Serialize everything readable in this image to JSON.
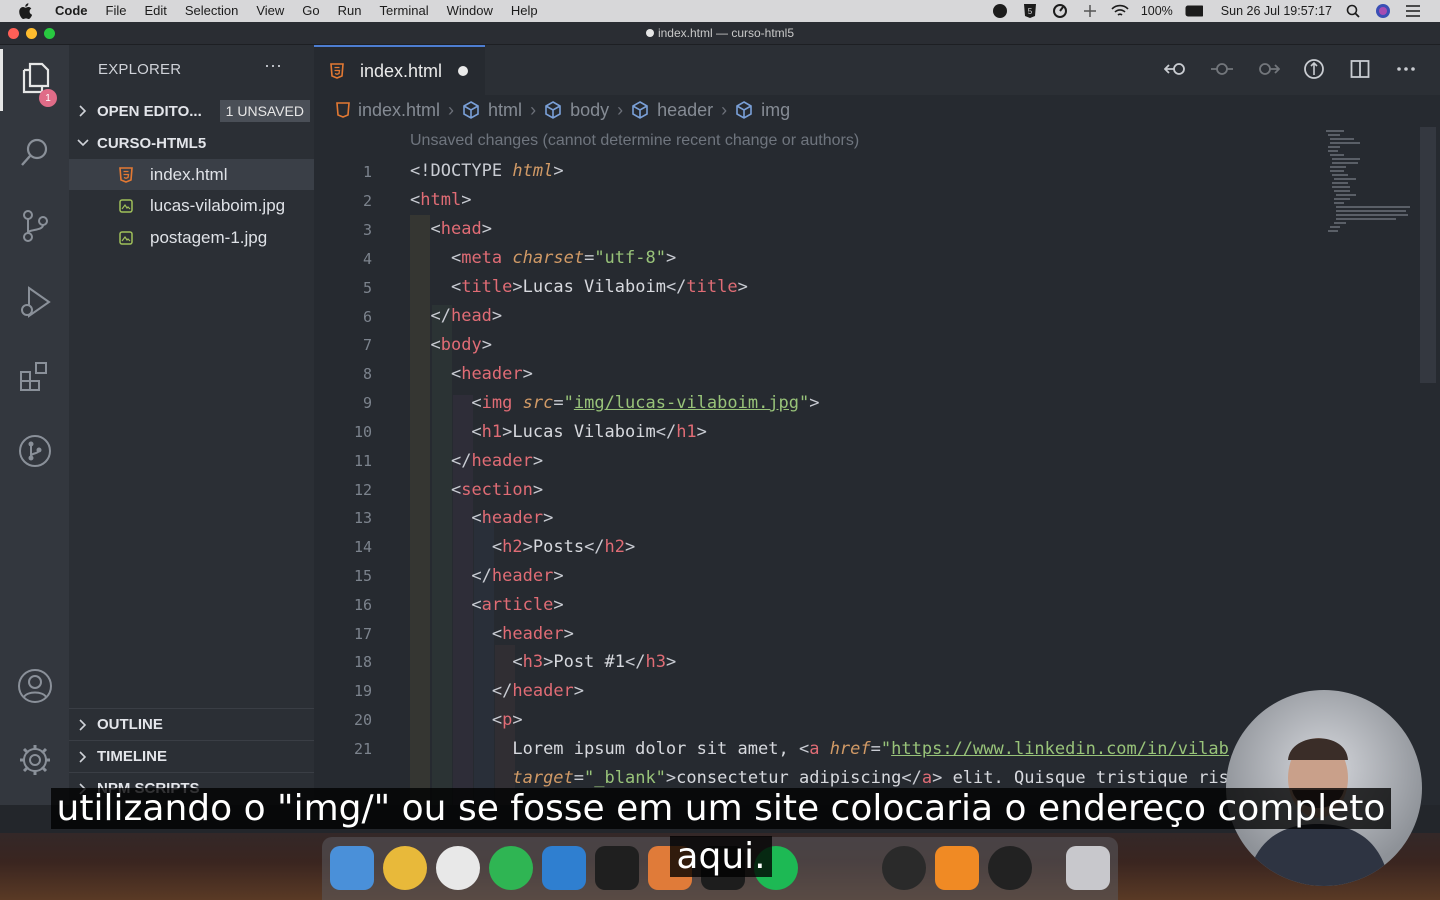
{
  "menubar": {
    "items": [
      "Code",
      "File",
      "Edit",
      "Selection",
      "View",
      "Go",
      "Run",
      "Terminal",
      "Window",
      "Help"
    ],
    "battery": "100%",
    "datetime": "Sun 26 Jul  19:57:17"
  },
  "window": {
    "title": "index.html — curso-html5"
  },
  "activity": {
    "explorer_badge": "1"
  },
  "sidebar": {
    "title": "EXPLORER",
    "more": "···",
    "open_editors": "OPEN EDITO...",
    "unsaved_badge": "1 UNSAVED",
    "folder": "CURSO-HTML5",
    "files": [
      "index.html",
      "lucas-vilaboim.jpg",
      "postagem-1.jpg"
    ],
    "panels": [
      "OUTLINE",
      "TIMELINE",
      "NPM SCRIPTS"
    ]
  },
  "editor": {
    "tab_label": "index.html",
    "breadcrumb": [
      "index.html",
      "html",
      "body",
      "header",
      "img"
    ],
    "codelens": "Unsaved changes (cannot determine recent change or authors)",
    "line_numbers": [
      "1",
      "2",
      "3",
      "4",
      "5",
      "6",
      "7",
      "8",
      "9",
      "10",
      "11",
      "12",
      "13",
      "14",
      "15",
      "16",
      "17",
      "18",
      "19",
      "20",
      "21"
    ]
  },
  "subtitle": {
    "line1": "utilizando o \"img/\" ou se fosse em um site colocaria o endereço completo",
    "line2": "aqui."
  },
  "colors": {
    "accent": "#4d7dd1",
    "tag": "#e06c75",
    "attribute": "#d19a66",
    "string": "#98c379",
    "badge": "#e06c88"
  }
}
